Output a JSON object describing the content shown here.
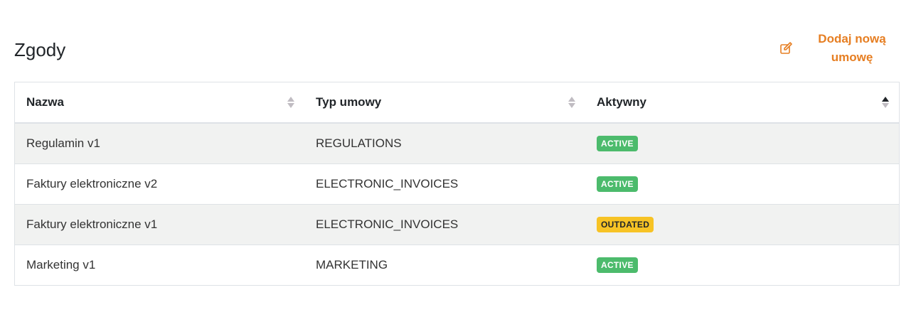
{
  "header": {
    "title": "Zgody",
    "add_button_label": "Dodaj nową umowę",
    "add_button_icon": "edit-icon"
  },
  "table": {
    "columns": [
      {
        "label": "Nazwa",
        "sort": "none"
      },
      {
        "label": "Typ umowy",
        "sort": "none"
      },
      {
        "label": "Aktywny",
        "sort": "ascending"
      }
    ],
    "rows": [
      {
        "name": "Regulamin v1",
        "type": "REGULATIONS",
        "status": "ACTIVE"
      },
      {
        "name": "Faktury elektroniczne v2",
        "type": "ELECTRONIC_INVOICES",
        "status": "ACTIVE"
      },
      {
        "name": "Faktury elektroniczne v1",
        "type": "ELECTRONIC_INVOICES",
        "status": "OUTDATED"
      },
      {
        "name": "Marketing v1",
        "type": "MARKETING",
        "status": "ACTIVE"
      }
    ]
  },
  "colors": {
    "accent": "#e67e22",
    "active_badge": "#4cbb6c",
    "outdated_badge": "#f7c325"
  }
}
